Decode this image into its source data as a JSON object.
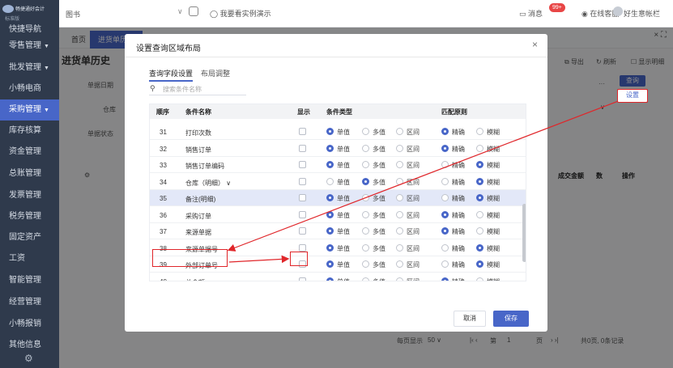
{
  "app": {
    "logo_name": "畅捷通好会计",
    "edition": "标准版"
  },
  "sidebar": {
    "items": [
      {
        "label": "快捷导航",
        "arrow": ""
      },
      {
        "label": "零售管理",
        "arrow": "▼"
      },
      {
        "label": "批发管理",
        "arrow": "▼"
      },
      {
        "label": "小畅电商",
        "arrow": ""
      },
      {
        "label": "采购管理",
        "arrow": "▼"
      },
      {
        "label": "库存核算",
        "arrow": ""
      },
      {
        "label": "资金管理",
        "arrow": ""
      },
      {
        "label": "总账管理",
        "arrow": ""
      },
      {
        "label": "发票管理",
        "arrow": ""
      },
      {
        "label": "税务管理",
        "arrow": ""
      },
      {
        "label": "固定资产",
        "arrow": ""
      },
      {
        "label": "工资",
        "arrow": ""
      },
      {
        "label": "智能管理",
        "arrow": ""
      },
      {
        "label": "经营管理",
        "arrow": ""
      },
      {
        "label": "小畅报销",
        "arrow": ""
      },
      {
        "label": "其他信息",
        "arrow": ""
      }
    ]
  },
  "topbar": {
    "breadcrumb": "图书",
    "demo": "我要看实例演示",
    "messages": "消息",
    "msg_badge": "99+",
    "service": "在线客服",
    "feedback": "好生意帐栏"
  },
  "tabs": [
    {
      "label": "首页"
    },
    {
      "label": "进货单历史"
    }
  ],
  "tab_actions": "×  ⛶",
  "page": {
    "title": "进货单历史",
    "labels": {
      "date": "单据日期",
      "warehouse": "仓库",
      "status": "单据状态"
    },
    "toolbar": {
      "export": "导出",
      "refresh": "刷新",
      "show_detail": "显示明细"
    },
    "query": "查询",
    "settings": "设置",
    "headers": [
      "成交金额",
      "数",
      "操作"
    ],
    "pager": {
      "per_page_label": "每页显示",
      "per_page": "50",
      "page_label": "第",
      "page": "1",
      "page_unit": "页",
      "total": "共0页, 0条记录"
    }
  },
  "modal": {
    "title": "设置查询区域布局",
    "tabs": [
      "查询字段设置",
      "布局调整"
    ],
    "search_placeholder": "搜索条件名称",
    "columns": [
      "顺序",
      "条件名称",
      "显示",
      "条件类型",
      "匹配原则"
    ],
    "type_options": [
      "单值",
      "多值",
      "区间"
    ],
    "match_options": [
      "精确",
      "模糊"
    ],
    "rows": [
      {
        "num": "31",
        "name": "打印次数",
        "type": 0,
        "match": 0
      },
      {
        "num": "32",
        "name": "销售订单",
        "type": 0,
        "match": 0
      },
      {
        "num": "33",
        "name": "销售订单编码",
        "type": 0,
        "match": 1
      },
      {
        "num": "34",
        "name": "仓库（明细） ∨",
        "type": 1,
        "match": 1
      },
      {
        "num": "35",
        "name": "备注(明细)",
        "type": 0,
        "match": 1
      },
      {
        "num": "36",
        "name": "采购订单",
        "type": 0,
        "match": 0
      },
      {
        "num": "37",
        "name": "来源单据",
        "type": 0,
        "match": 0
      },
      {
        "num": "38",
        "name": "来源单据号",
        "type": 0,
        "match": 1
      },
      {
        "num": "39",
        "name": "外部订单号",
        "type": 0,
        "match": 1
      },
      {
        "num": "40",
        "name": "总金额",
        "type": 0,
        "match": 0
      }
    ],
    "cancel": "取消",
    "save": "保存"
  },
  "colors": {
    "primary": "#4866c8",
    "annotation": "#e0262a",
    "sidebar": "#2f3a4c",
    "highlight_row": "#e3e8f8"
  }
}
